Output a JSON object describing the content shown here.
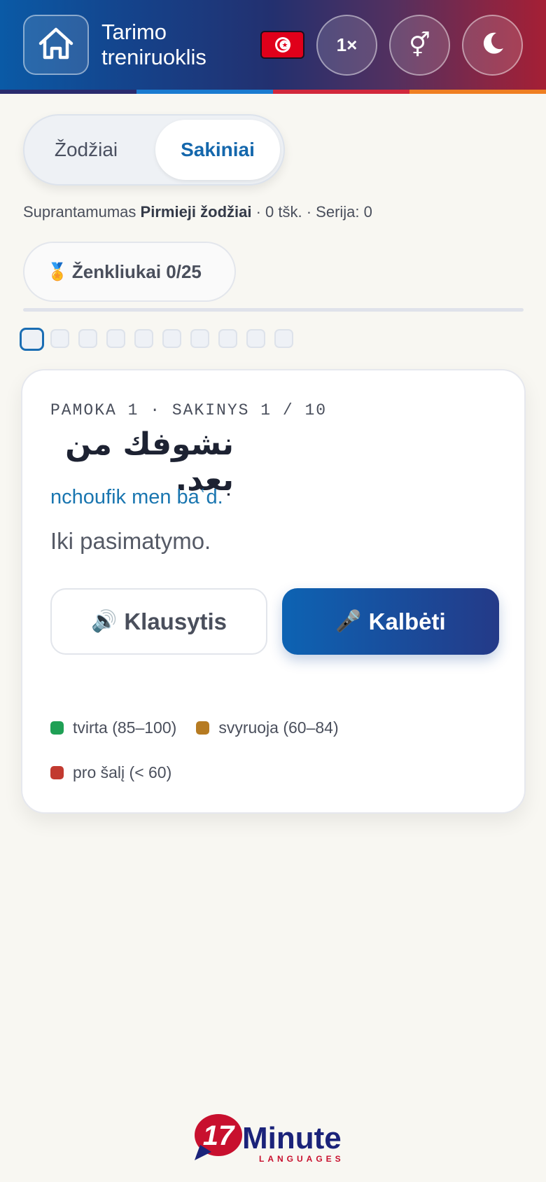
{
  "header": {
    "title_line1": "Tarimo",
    "title_line2": "treniruoklis",
    "flag": "tunisia-flag",
    "speed_label": "1×",
    "gender_icon": "⚥",
    "theme_icon": "moon-icon",
    "home_icon": "home-icon",
    "stripe_colors": [
      "#2a2b6e",
      "#1a7bd0",
      "#d2283c",
      "#ef7f22"
    ]
  },
  "toggle": {
    "words_label": "Žodžiai",
    "sentences_label": "Sakiniai",
    "active": "sentences"
  },
  "status": {
    "prefix": "Suprantamumas",
    "level": "Pirmieji žodžiai",
    "rest": "· 0 tšk. · Serija: 0"
  },
  "badges": {
    "medal_icon": "🏅",
    "label": "Ženkliukai",
    "count": "0/25"
  },
  "progress": {
    "total_steps": 10,
    "current_step": 1
  },
  "card": {
    "lesson_label": "PAMOKA 1 · SAKINYS 1 / 10",
    "arabic": "نشوفك من بعد.",
    "transliteration": "nchoufik men baʿd.",
    "translation": "Iki pasimatymo.",
    "listen_icon": "🔊",
    "listen_label": "Klausytis",
    "speak_icon": "🎤",
    "speak_label": "Kalbėti",
    "legend": [
      {
        "label": "tvirta (85–100)",
        "color": "#1fa055"
      },
      {
        "label": "svyruoja (60–84)",
        "color": "#b67b22"
      },
      {
        "label": "pro šalį (< 60)",
        "color": "#c23a30"
      }
    ]
  },
  "logo": {
    "number": "17",
    "word": "Minute",
    "sub": "LANGUAGES",
    "colors": {
      "red": "#c8102e",
      "navy": "#1b237a"
    }
  }
}
